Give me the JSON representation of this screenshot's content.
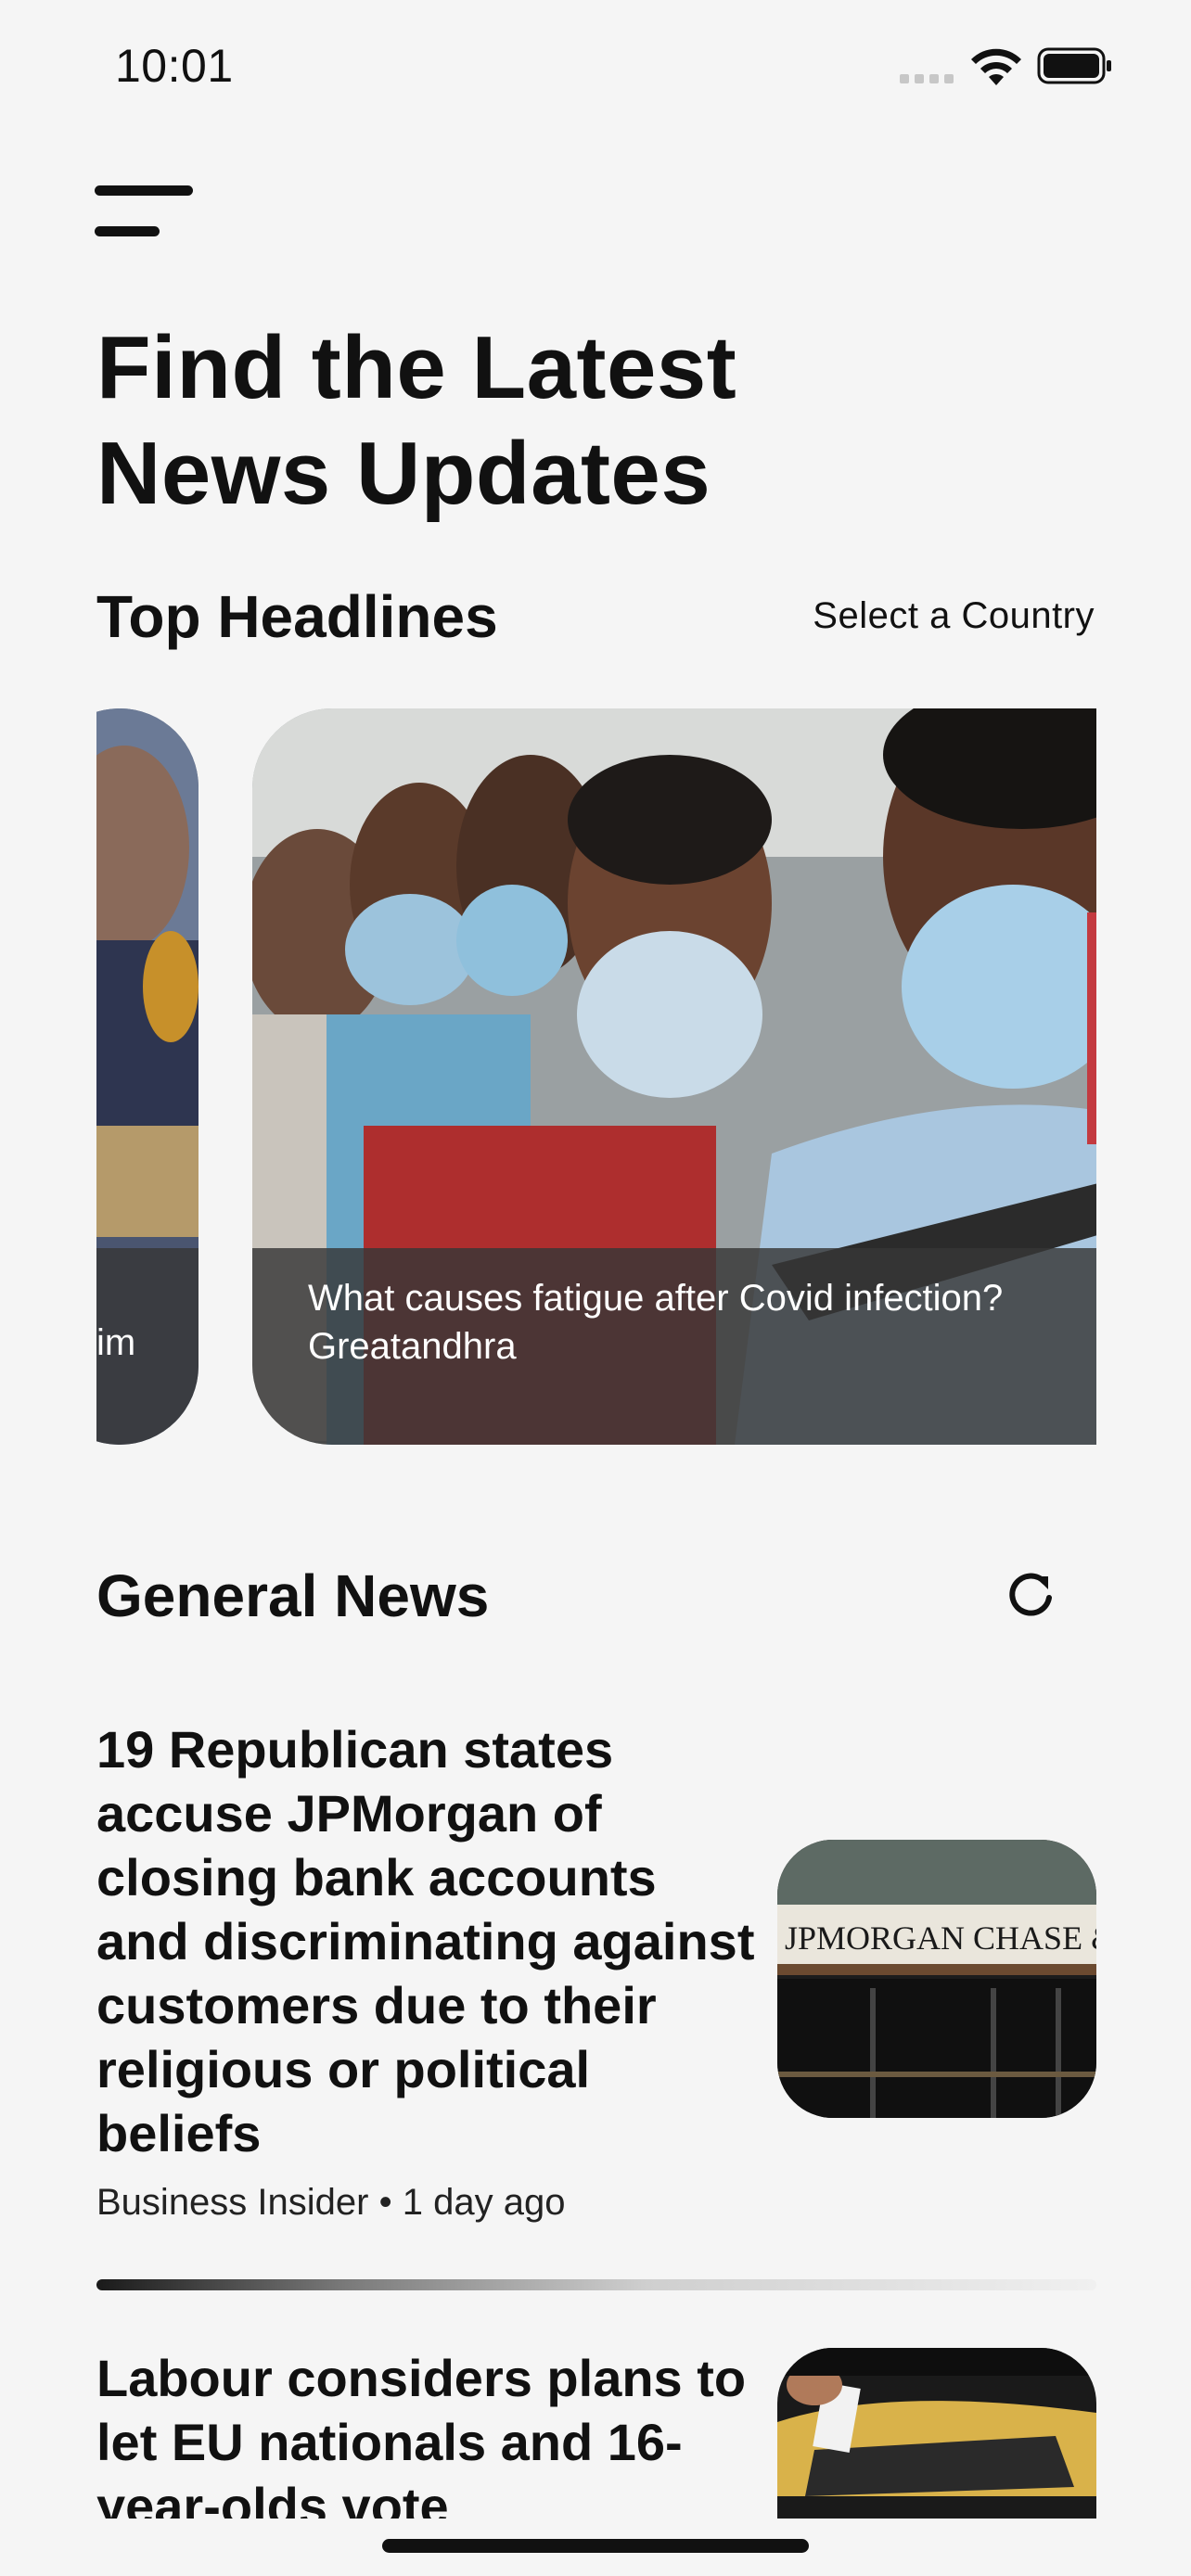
{
  "status_bar": {
    "time": "10:01"
  },
  "header": {
    "title_line1": "Find the Latest",
    "title_line2": "News Updates"
  },
  "top_headlines": {
    "heading": "Top Headlines",
    "select_country_label": "Select a Country",
    "cards": [
      {
        "caption_line1": "im",
        "caption_line2": ""
      },
      {
        "caption_line1": "What causes fatigue after Covid infection?",
        "caption_line2": "Greatandhra"
      }
    ]
  },
  "general_news": {
    "heading": "General News",
    "items": [
      {
        "title": "19 Republican states accuse JPMorgan of closing bank accounts and discriminating against customers due to their religious or political beliefs",
        "source": "Business Insider",
        "separator": "•",
        "time": "1 day ago",
        "thumb_sign": "JPMORGAN CHASE &"
      },
      {
        "title": "Labour considers plans to let EU nationals and 16-year-olds vote",
        "source": "",
        "time": ""
      }
    ]
  },
  "colors": {
    "background": "#f5f5f5",
    "text": "#111111",
    "caption_overlay": "#373737"
  },
  "icons": [
    "menu-icon",
    "refresh-icon",
    "wifi-icon",
    "battery-icon",
    "signal-icon"
  ]
}
